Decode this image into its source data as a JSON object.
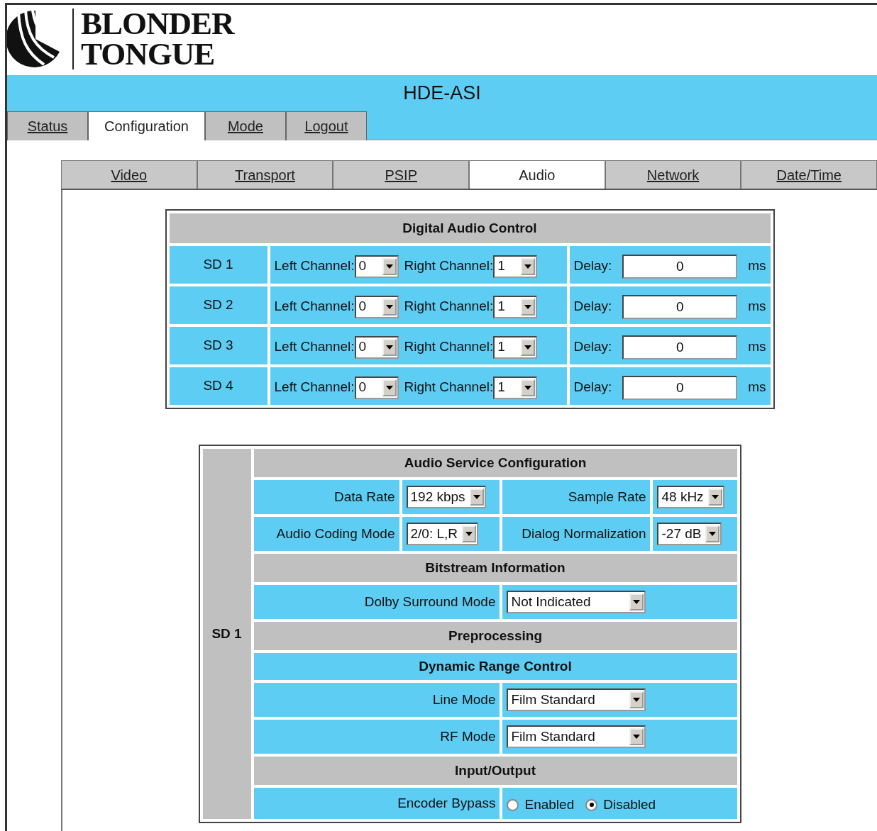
{
  "logo": {
    "lines": [
      "BLONDER",
      "TONGUE"
    ]
  },
  "title": "HDE-ASI",
  "main_tabs": [
    {
      "label": "Status",
      "selected": false
    },
    {
      "label": "Configuration",
      "selected": true
    },
    {
      "label": "Mode",
      "selected": false
    },
    {
      "label": "Logout",
      "selected": false
    }
  ],
  "sub_tabs": [
    {
      "label": "Video",
      "selected": false
    },
    {
      "label": "Transport",
      "selected": false
    },
    {
      "label": "PSIP",
      "selected": false
    },
    {
      "label": "Audio",
      "selected": true
    },
    {
      "label": "Network",
      "selected": false
    },
    {
      "label": "Date/Time",
      "selected": false
    }
  ],
  "digital_audio_control": {
    "title": "Digital Audio Control",
    "rows": [
      {
        "name": "SD 1",
        "left_label": "Left Channel:",
        "left_value": "0",
        "right_label": "Right Channel:",
        "right_value": "1",
        "delay_label": "Delay:",
        "delay_value": "0",
        "unit": "ms"
      },
      {
        "name": "SD 2",
        "left_label": "Left Channel:",
        "left_value": "0",
        "right_label": "Right Channel:",
        "right_value": "1",
        "delay_label": "Delay:",
        "delay_value": "0",
        "unit": "ms"
      },
      {
        "name": "SD 3",
        "left_label": "Left Channel:",
        "left_value": "0",
        "right_label": "Right Channel:",
        "right_value": "1",
        "delay_label": "Delay:",
        "delay_value": "0",
        "unit": "ms"
      },
      {
        "name": "SD 4",
        "left_label": "Left Channel:",
        "left_value": "0",
        "right_label": "Right Channel:",
        "right_value": "1",
        "delay_label": "Delay:",
        "delay_value": "0",
        "unit": "ms"
      }
    ]
  },
  "service": {
    "channel": "SD 1",
    "rows": [
      {
        "kind": "header",
        "text": "Audio Service Configuration"
      },
      {
        "kind": "pair",
        "fields": [
          {
            "label": "Data Rate",
            "value": "192 kbps"
          },
          {
            "label": "Sample Rate",
            "value": "48 kHz"
          }
        ]
      },
      {
        "kind": "pair",
        "fields": [
          {
            "label": "Audio Coding Mode",
            "value": "2/0: L,R"
          },
          {
            "label": "Dialog Normalization",
            "value": "-27 dB"
          }
        ]
      },
      {
        "kind": "header",
        "text": "Bitstream Information"
      },
      {
        "kind": "select",
        "label": "Dolby Surround Mode",
        "value": "Not Indicated"
      },
      {
        "kind": "header",
        "text": "Preprocessing"
      },
      {
        "kind": "subheader",
        "text": "Dynamic Range Control"
      },
      {
        "kind": "select",
        "label": "Line Mode",
        "value": "Film Standard"
      },
      {
        "kind": "select",
        "label": "RF Mode",
        "value": "Film Standard"
      },
      {
        "kind": "header",
        "text": "Input/Output"
      },
      {
        "kind": "radio",
        "label": "Encoder Bypass",
        "options": [
          {
            "label": "Enabled",
            "selected": false
          },
          {
            "label": "Disabled",
            "selected": true
          }
        ]
      }
    ]
  }
}
